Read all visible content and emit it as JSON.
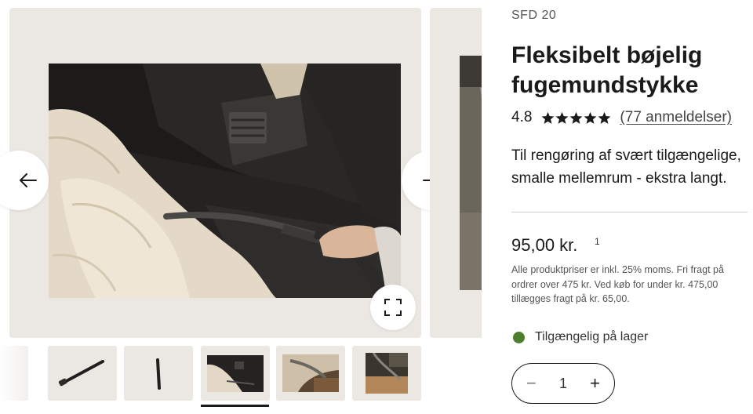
{
  "gallery": {
    "prev_icon": "arrow-left-icon",
    "next_icon": "arrow-right-icon",
    "expand_icon": "expand-icon",
    "thumbnails": [
      {
        "name": "thumb-partial",
        "active": false
      },
      {
        "name": "thumb-nozzle-angled",
        "active": false
      },
      {
        "name": "thumb-nozzle-vertical",
        "active": false
      },
      {
        "name": "thumb-car-interior",
        "active": true
      },
      {
        "name": "thumb-car-seat",
        "active": false
      },
      {
        "name": "thumb-car-floor",
        "active": false
      }
    ]
  },
  "product": {
    "sku": "SFD 20",
    "title": "Fleksibelt bøjelig fugemundstykke",
    "rating": "4.8",
    "stars": 4.8,
    "reviews_link": "(77 anmeldelser)",
    "description": "Til rengøring af svært tilgængelige, smalle mellemrum - ekstra langt.",
    "price": "95,00 kr.",
    "price_footnote": "1",
    "price_info": "Alle produktpriser er inkl. 25% moms. Fri fragt på ordrer over 475 kr. Ved køb for under kr. 475,00 tillægges fragt på kr. 65,00.",
    "stock_status": "Tilgængelig på lager",
    "stock_color": "#4c7e2e",
    "quantity": {
      "minus": "−",
      "value": "1",
      "plus": "+"
    }
  }
}
